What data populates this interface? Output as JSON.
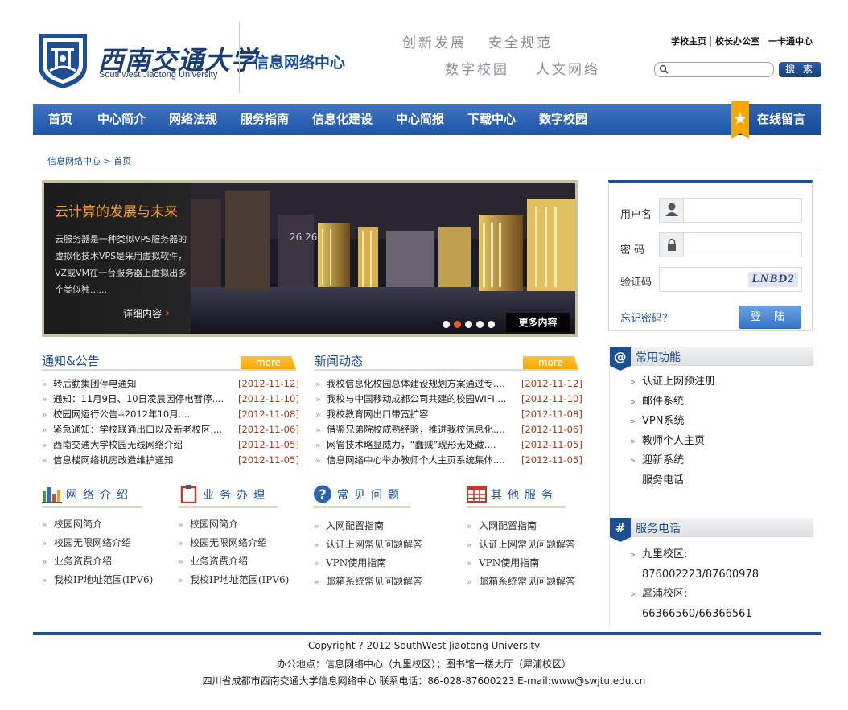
{
  "header": {
    "logo_cn": "西南交通大学",
    "logo_en": "Southwest Jiaotong University",
    "dept_name": "信息网络中心",
    "slogans": [
      "创新发展",
      "安全规范",
      "数字校园",
      "人文网络"
    ],
    "top_links": [
      "学校主页",
      "校长办公室",
      "一卡通中心"
    ],
    "search_placeholder": "",
    "search_button": "搜 索"
  },
  "nav": {
    "items": [
      "首页",
      "中心简介",
      "网络法规",
      "服务指南",
      "信息化建设",
      "中心简报",
      "下载中心",
      "数字校园"
    ],
    "message": "在线留言"
  },
  "breadcrumb": "信息网络中心 > 首页",
  "banner": {
    "title": "云计算的发展与未来",
    "description": "云服务器是一种类似VPS服务器的虚拟化技术VPS是采用虚拟软件，VZ或VM在一台服务器上虚拟出多个类似独......",
    "detail_link": "详细内容",
    "more_content": "更多内容",
    "slide_count": 5,
    "active_slide": 2
  },
  "login": {
    "username_label": "用户名",
    "password_label": "密  码",
    "captcha_label": "验证码",
    "captcha_text": "LNBD2",
    "forgot": "忘记密码？",
    "submit": "登  陆"
  },
  "notices": {
    "title": "通知&公告",
    "more": "more",
    "items": [
      {
        "text": "转后勤集团停电通知",
        "date": "[2012-11-12]"
      },
      {
        "text": "通知：11月9日、10日凌晨因停电暂停....",
        "date": "[2012-11-10]"
      },
      {
        "text": "校园网运行公告--2012年10月....",
        "date": "[2012-11-08]"
      },
      {
        "text": "紧急通知：学校联通出口以及新老校区....",
        "date": "[2012-11-06]"
      },
      {
        "text": "西南交通大学校园无线网络介绍",
        "date": "[2012-11-05]"
      },
      {
        "text": "信息楼网络机房改造维护通知",
        "date": "[2012-11-05]"
      }
    ]
  },
  "news": {
    "title": "新闻动态",
    "more": "more",
    "items": [
      {
        "text": "我校信息化校园总体建设规划方案通过专....",
        "date": "[2012-11-12]"
      },
      {
        "text": "我校与中国移动成都公司共建的校园WIFI....",
        "date": "[2012-11-10]"
      },
      {
        "text": "我校教育网出口带宽扩容",
        "date": "[2012-11-08]"
      },
      {
        "text": "借鉴兄弟院校成熟经验，推进我校信息化....",
        "date": "[2012-11-06]"
      },
      {
        "text": "网管技术略显威力，“蠢贼”现形无处藏....",
        "date": "[2012-11-05]"
      },
      {
        "text": "信息网络中心举办教师个人主页系统集体....",
        "date": "[2012-11-05]"
      }
    ]
  },
  "categories": [
    {
      "title": "网络介绍",
      "icon": "bar-chart-icon",
      "items": [
        "校园网简介",
        "校园无限网络介绍",
        "业务资费介绍",
        "我校IP地址范围(IPV6)"
      ]
    },
    {
      "title": "业务办理",
      "icon": "clipboard-icon",
      "items": [
        "校园网简介",
        "校园无限网络介绍",
        "业务资费介绍",
        "我校IP地址范围(IPV6)"
      ]
    },
    {
      "title": "常见问题",
      "icon": "question-icon",
      "items": [
        "入网配置指南",
        "认证上网常见问题解答",
        "VPN使用指南",
        "邮箱系统常见问题解答"
      ]
    },
    {
      "title": "其他服务",
      "icon": "table-icon",
      "items": [
        "入网配置指南",
        "认证上网常见问题解答",
        "VPN使用指南",
        "邮箱系统常见问题解答"
      ]
    }
  ],
  "functions": {
    "badge": "@",
    "title": "常用功能",
    "items": [
      "认证上网预注册",
      "邮件系统",
      "VPN系统",
      "教师个人主页",
      "迎新系统",
      "服务电话"
    ]
  },
  "service_phone": {
    "badge": "#",
    "title": "服务电话",
    "lines": [
      "九里校区:",
      "876002223/87600978",
      "犀浦校区:",
      "66366560/66366561"
    ]
  },
  "footer": {
    "copyright": "Copyright ? 2012 SouthWest Jiaotong University",
    "address": "办公地点：信息网络中心（九里校区）；图书馆一楼大厅（犀浦校区）",
    "contact": "四川省成都市西南交通大学信息网络中心 联系电话：86-028-87600223 E-mail:www@swjtu.edu.cn"
  },
  "colors": {
    "brand_blue": "#1c4e94",
    "nav_blue": "#2e64b0",
    "accent_orange": "#f6a800",
    "date_red": "#a23a17"
  }
}
